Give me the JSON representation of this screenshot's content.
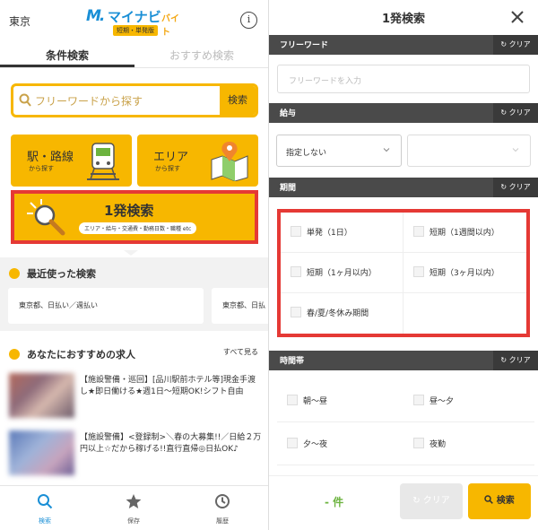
{
  "left": {
    "header": {
      "location": "東京",
      "logo_mark": "M.",
      "logo_main": "マイナビ",
      "logo_sub": "バイト",
      "logo_badge": "短期・単発版",
      "info_glyph": "i"
    },
    "tabs": [
      {
        "label": "条件検索",
        "active": true
      },
      {
        "label": "おすすめ検索",
        "active": false
      }
    ],
    "search": {
      "placeholder": "フリーワードから探す",
      "button_label": "検索"
    },
    "tiles": [
      {
        "title": "駅・路線",
        "subtitle": "から探す",
        "icon": "train-icon"
      },
      {
        "title": "エリア",
        "subtitle": "から探す",
        "icon": "map-icon"
      }
    ],
    "one_search": {
      "title": "1発検索",
      "subtitle": "エリア・給与・交通費・勤務日数・職種 etc"
    },
    "recent": {
      "heading": "最近使った検索",
      "items": [
        "東京都、日払い／週払い",
        "東京都、日払"
      ]
    },
    "recommended": {
      "heading": "あなたにおすすめの求人",
      "more_label": "すべて見る",
      "jobs": [
        {
          "title": "【施設警備・巡回】[品川駅前ホテル等]現金手渡し★即日働ける★週1日〜短期OK!シフト自由"
        },
        {
          "title": "【施設警備】<登録制>＼春の大募集!!／日給２万円以上☆だから稼げる!!直行直帰◎日払OK♪"
        }
      ]
    },
    "bottom_nav": [
      {
        "label": "検索",
        "icon": "search-icon",
        "active": true
      },
      {
        "label": "保存",
        "icon": "star-icon",
        "active": false
      },
      {
        "label": "履歴",
        "icon": "history-icon",
        "active": false
      }
    ]
  },
  "right": {
    "header": {
      "title": "1発検索",
      "close_glyph": "✕"
    },
    "clear_label": "クリア",
    "sections": {
      "freeword": {
        "label": "フリーワード",
        "placeholder": "フリーワードを入力"
      },
      "salary": {
        "label": "給与",
        "select_value": "指定しない"
      },
      "period": {
        "label": "期間",
        "options": [
          "単発（1日）",
          "短期（1週間以内）",
          "短期（1ヶ月以内）",
          "短期（3ヶ月以内）",
          "春/夏/冬休み期間"
        ]
      },
      "timeband": {
        "label": "時間帯",
        "options": [
          "朝〜昼",
          "昼〜夕",
          "夕〜夜",
          "夜勤"
        ]
      }
    },
    "footer": {
      "count": "- 件",
      "clear_label": "クリア",
      "search_label": "検索"
    }
  },
  "colors": {
    "accent": "#f7b700",
    "brand_blue": "#1a8fd6",
    "highlight_red": "#e53935",
    "section_bar": "#4a4a4a",
    "count_green": "#6cb33f"
  }
}
